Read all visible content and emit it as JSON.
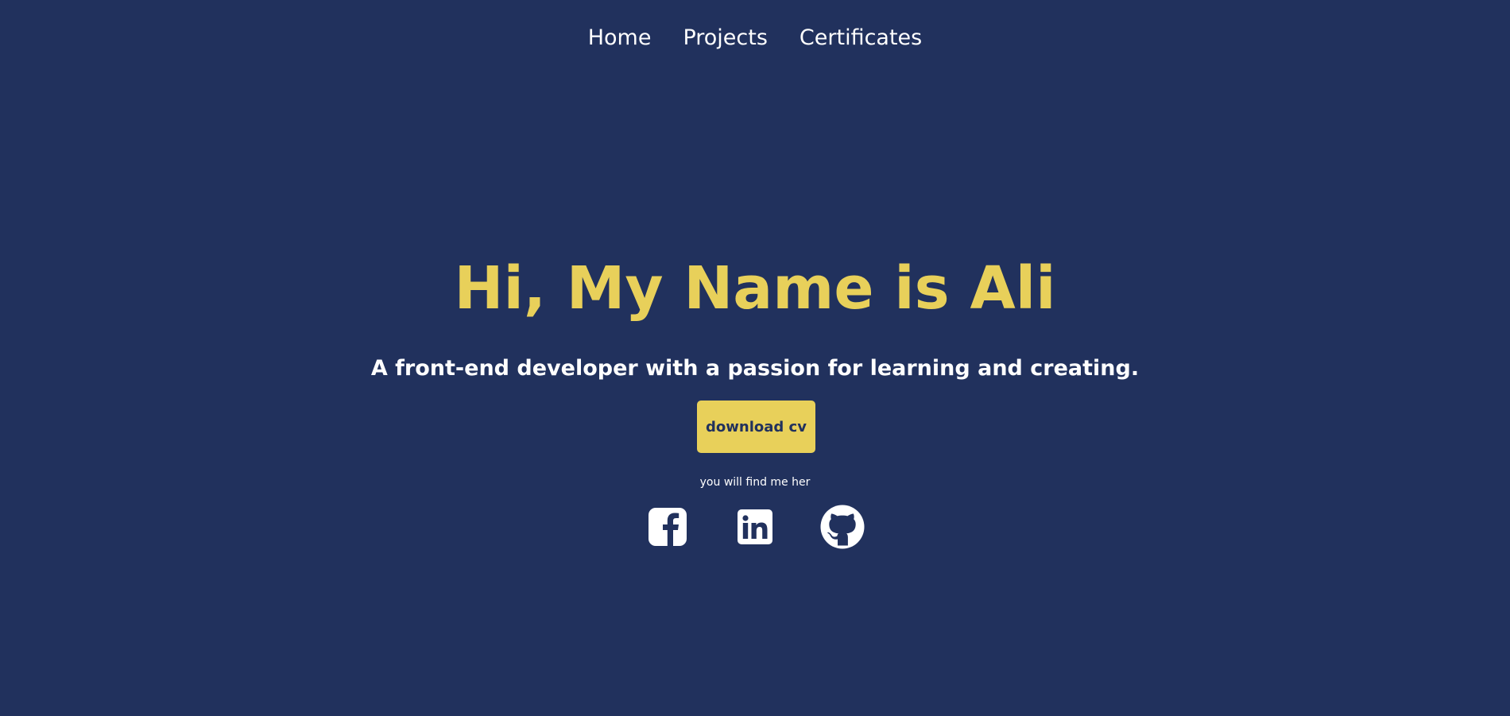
{
  "nav": {
    "items": [
      {
        "label": "Home"
      },
      {
        "label": "Projects"
      },
      {
        "label": "Certificates"
      }
    ]
  },
  "hero": {
    "title": "Hi, My Name is Ali",
    "subtitle": "A front-end developer with a passion for learning and creating.",
    "button_label": "download cv",
    "find_text": "you will find me her"
  },
  "social": {
    "icons": [
      "facebook-icon",
      "linkedin-icon",
      "github-icon"
    ]
  },
  "colors": {
    "background": "#21315d",
    "accent": "#e8d05a",
    "text": "#ffffff"
  }
}
